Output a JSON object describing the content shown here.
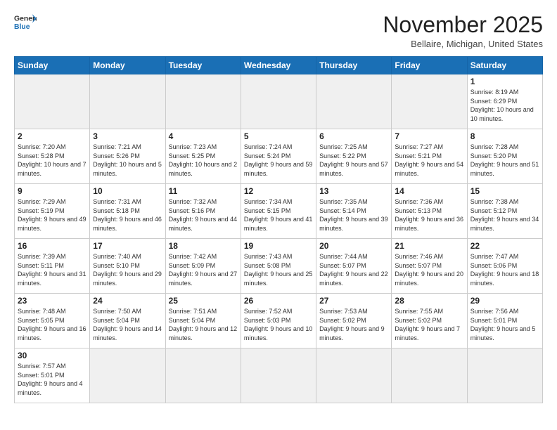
{
  "header": {
    "logo_general": "General",
    "logo_blue": "Blue",
    "month_title": "November 2025",
    "location": "Bellaire, Michigan, United States"
  },
  "days_of_week": [
    "Sunday",
    "Monday",
    "Tuesday",
    "Wednesday",
    "Thursday",
    "Friday",
    "Saturday"
  ],
  "weeks": [
    [
      {
        "day": "",
        "empty": true
      },
      {
        "day": "",
        "empty": true
      },
      {
        "day": "",
        "empty": true
      },
      {
        "day": "",
        "empty": true
      },
      {
        "day": "",
        "empty": true
      },
      {
        "day": "",
        "empty": true
      },
      {
        "day": "1",
        "sunrise": "8:19 AM",
        "sunset": "6:29 PM",
        "daylight": "10 hours and 10 minutes."
      }
    ],
    [
      {
        "day": "2",
        "sunrise": "7:20 AM",
        "sunset": "5:28 PM",
        "daylight": "10 hours and 7 minutes."
      },
      {
        "day": "3",
        "sunrise": "7:21 AM",
        "sunset": "5:26 PM",
        "daylight": "10 hours and 5 minutes."
      },
      {
        "day": "4",
        "sunrise": "7:23 AM",
        "sunset": "5:25 PM",
        "daylight": "10 hours and 2 minutes."
      },
      {
        "day": "5",
        "sunrise": "7:24 AM",
        "sunset": "5:24 PM",
        "daylight": "9 hours and 59 minutes."
      },
      {
        "day": "6",
        "sunrise": "7:25 AM",
        "sunset": "5:22 PM",
        "daylight": "9 hours and 57 minutes."
      },
      {
        "day": "7",
        "sunrise": "7:27 AM",
        "sunset": "5:21 PM",
        "daylight": "9 hours and 54 minutes."
      },
      {
        "day": "8",
        "sunrise": "7:28 AM",
        "sunset": "5:20 PM",
        "daylight": "9 hours and 51 minutes."
      }
    ],
    [
      {
        "day": "9",
        "sunrise": "7:29 AM",
        "sunset": "5:19 PM",
        "daylight": "9 hours and 49 minutes."
      },
      {
        "day": "10",
        "sunrise": "7:31 AM",
        "sunset": "5:18 PM",
        "daylight": "9 hours and 46 minutes."
      },
      {
        "day": "11",
        "sunrise": "7:32 AM",
        "sunset": "5:16 PM",
        "daylight": "9 hours and 44 minutes."
      },
      {
        "day": "12",
        "sunrise": "7:34 AM",
        "sunset": "5:15 PM",
        "daylight": "9 hours and 41 minutes."
      },
      {
        "day": "13",
        "sunrise": "7:35 AM",
        "sunset": "5:14 PM",
        "daylight": "9 hours and 39 minutes."
      },
      {
        "day": "14",
        "sunrise": "7:36 AM",
        "sunset": "5:13 PM",
        "daylight": "9 hours and 36 minutes."
      },
      {
        "day": "15",
        "sunrise": "7:38 AM",
        "sunset": "5:12 PM",
        "daylight": "9 hours and 34 minutes."
      }
    ],
    [
      {
        "day": "16",
        "sunrise": "7:39 AM",
        "sunset": "5:11 PM",
        "daylight": "9 hours and 31 minutes."
      },
      {
        "day": "17",
        "sunrise": "7:40 AM",
        "sunset": "5:10 PM",
        "daylight": "9 hours and 29 minutes."
      },
      {
        "day": "18",
        "sunrise": "7:42 AM",
        "sunset": "5:09 PM",
        "daylight": "9 hours and 27 minutes."
      },
      {
        "day": "19",
        "sunrise": "7:43 AM",
        "sunset": "5:08 PM",
        "daylight": "9 hours and 25 minutes."
      },
      {
        "day": "20",
        "sunrise": "7:44 AM",
        "sunset": "5:07 PM",
        "daylight": "9 hours and 22 minutes."
      },
      {
        "day": "21",
        "sunrise": "7:46 AM",
        "sunset": "5:07 PM",
        "daylight": "9 hours and 20 minutes."
      },
      {
        "day": "22",
        "sunrise": "7:47 AM",
        "sunset": "5:06 PM",
        "daylight": "9 hours and 18 minutes."
      }
    ],
    [
      {
        "day": "23",
        "sunrise": "7:48 AM",
        "sunset": "5:05 PM",
        "daylight": "9 hours and 16 minutes."
      },
      {
        "day": "24",
        "sunrise": "7:50 AM",
        "sunset": "5:04 PM",
        "daylight": "9 hours and 14 minutes."
      },
      {
        "day": "25",
        "sunrise": "7:51 AM",
        "sunset": "5:04 PM",
        "daylight": "9 hours and 12 minutes."
      },
      {
        "day": "26",
        "sunrise": "7:52 AM",
        "sunset": "5:03 PM",
        "daylight": "9 hours and 10 minutes."
      },
      {
        "day": "27",
        "sunrise": "7:53 AM",
        "sunset": "5:02 PM",
        "daylight": "9 hours and 9 minutes."
      },
      {
        "day": "28",
        "sunrise": "7:55 AM",
        "sunset": "5:02 PM",
        "daylight": "9 hours and 7 minutes."
      },
      {
        "day": "29",
        "sunrise": "7:56 AM",
        "sunset": "5:01 PM",
        "daylight": "9 hours and 5 minutes."
      }
    ],
    [
      {
        "day": "30",
        "sunrise": "7:57 AM",
        "sunset": "5:01 PM",
        "daylight": "9 hours and 4 minutes."
      },
      {
        "day": "",
        "empty": true
      },
      {
        "day": "",
        "empty": true
      },
      {
        "day": "",
        "empty": true
      },
      {
        "day": "",
        "empty": true
      },
      {
        "day": "",
        "empty": true
      },
      {
        "day": "",
        "empty": true
      }
    ]
  ]
}
